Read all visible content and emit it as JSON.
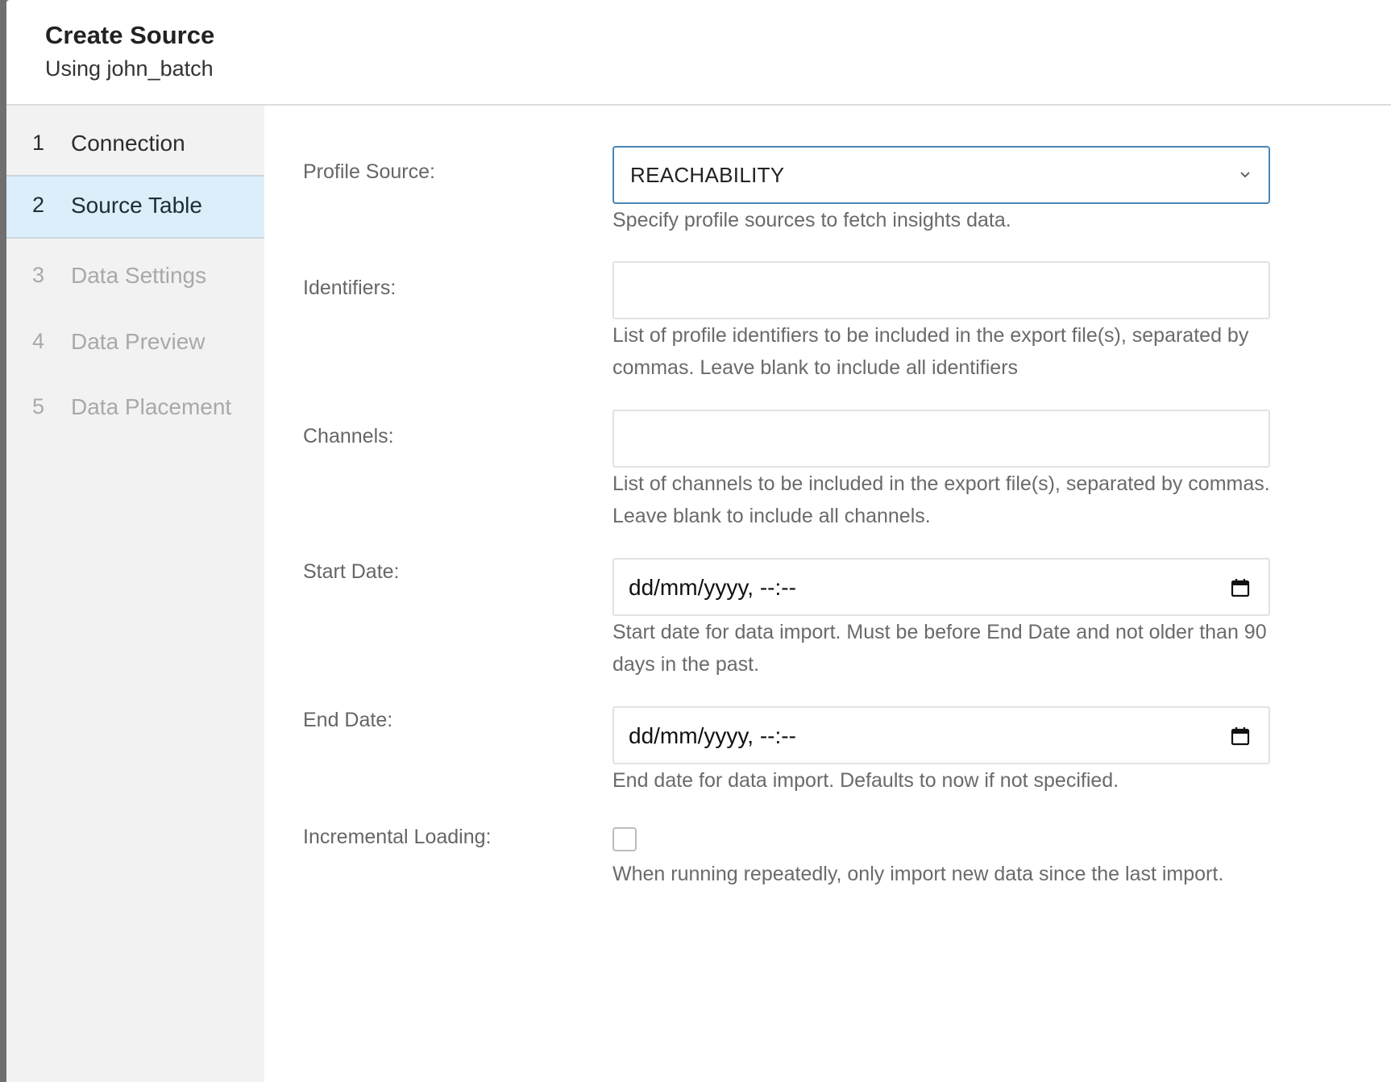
{
  "header": {
    "title": "Create Source",
    "subtitle": "Using john_batch"
  },
  "steps": [
    {
      "number": "1",
      "label": "Connection",
      "state": "done"
    },
    {
      "number": "2",
      "label": "Source Table",
      "state": "active"
    },
    {
      "number": "3",
      "label": "Data Settings",
      "state": "pending"
    },
    {
      "number": "4",
      "label": "Data Preview",
      "state": "pending"
    },
    {
      "number": "5",
      "label": "Data Placement",
      "state": "pending"
    }
  ],
  "form": {
    "profile_source": {
      "label": "Profile Source:",
      "value": "REACHABILITY",
      "help": "Specify profile sources to fetch insights data.",
      "icon": "chevron-down-icon"
    },
    "identifiers": {
      "label": "Identifiers:",
      "value": "",
      "help": "List of profile identifiers to be included in the export file(s), separated by commas. Leave blank to include all identifiers"
    },
    "channels": {
      "label": "Channels:",
      "value": "",
      "help": "List of channels to be included in the export file(s), separated by commas. Leave blank to include all channels."
    },
    "start_date": {
      "label": "Start Date:",
      "value": "dd/mm/yyyy, --:--",
      "help": "Start date for data import. Must be before End Date and not older than 90 days in the past.",
      "icon": "calendar-icon"
    },
    "end_date": {
      "label": "End Date:",
      "value": "dd/mm/yyyy, --:--",
      "help": "End date for data import. Defaults to now if not specified.",
      "icon": "calendar-icon"
    },
    "incremental_loading": {
      "label": "Incremental Loading:",
      "checked": false,
      "help": "When running repeatedly, only import new data since the last import."
    }
  },
  "colors": {
    "active_step_bg": "#dbeefa",
    "select_border": "#4a86b8",
    "sidebar_bg": "#f2f2f2",
    "help_text": "#6a6a6a"
  }
}
